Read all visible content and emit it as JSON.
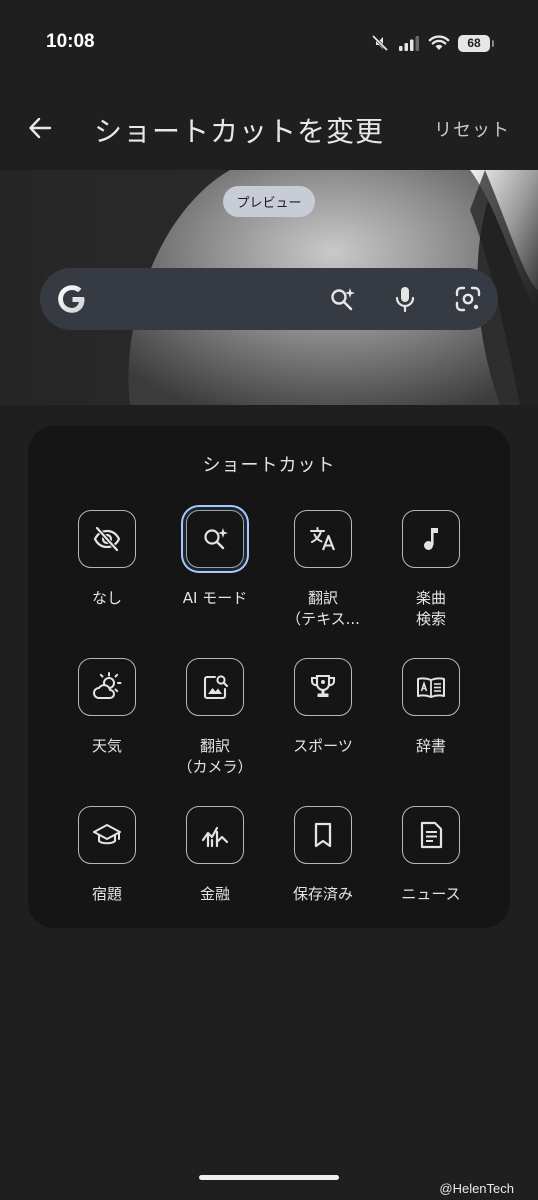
{
  "status_bar": {
    "time": "10:08",
    "battery": "68",
    "icons": [
      "mute-icon",
      "signal-icon",
      "wifi-icon",
      "battery-icon"
    ]
  },
  "app_bar": {
    "back_icon": "arrow-back-icon",
    "title": "ショートカットを変更",
    "reset_label": "リセット"
  },
  "preview": {
    "chip_label": "プレビュー",
    "search_bar_icons": [
      "google-logo",
      "ai-mode-icon",
      "mic-icon",
      "lens-icon"
    ]
  },
  "shortcuts": {
    "title": "ショートカット",
    "selected_index": 1,
    "items": [
      {
        "label": "なし",
        "icon": "eye-off-icon"
      },
      {
        "label": "AI モード",
        "icon": "ai-mode-icon"
      },
      {
        "label": "翻訳\n（テキス...",
        "icon": "translate-icon"
      },
      {
        "label": "楽曲\n検索",
        "icon": "music-note-icon"
      },
      {
        "label": "天気",
        "icon": "weather-icon"
      },
      {
        "label": "翻訳\n（カメラ）",
        "icon": "image-search-icon"
      },
      {
        "label": "スポーツ",
        "icon": "trophy-icon"
      },
      {
        "label": "辞書",
        "icon": "dictionary-icon"
      },
      {
        "label": "宿題",
        "icon": "graduation-cap-icon"
      },
      {
        "label": "金融",
        "icon": "finance-chart-icon"
      },
      {
        "label": "保存済み",
        "icon": "bookmark-icon"
      },
      {
        "label": "ニュース",
        "icon": "news-icon"
      }
    ]
  },
  "watermark": "@HelenTech",
  "colors": {
    "background": "#1f1f1f",
    "panel": "#151515",
    "selected_ring": "#a8c7fa",
    "chip": "#c7ccd6"
  }
}
